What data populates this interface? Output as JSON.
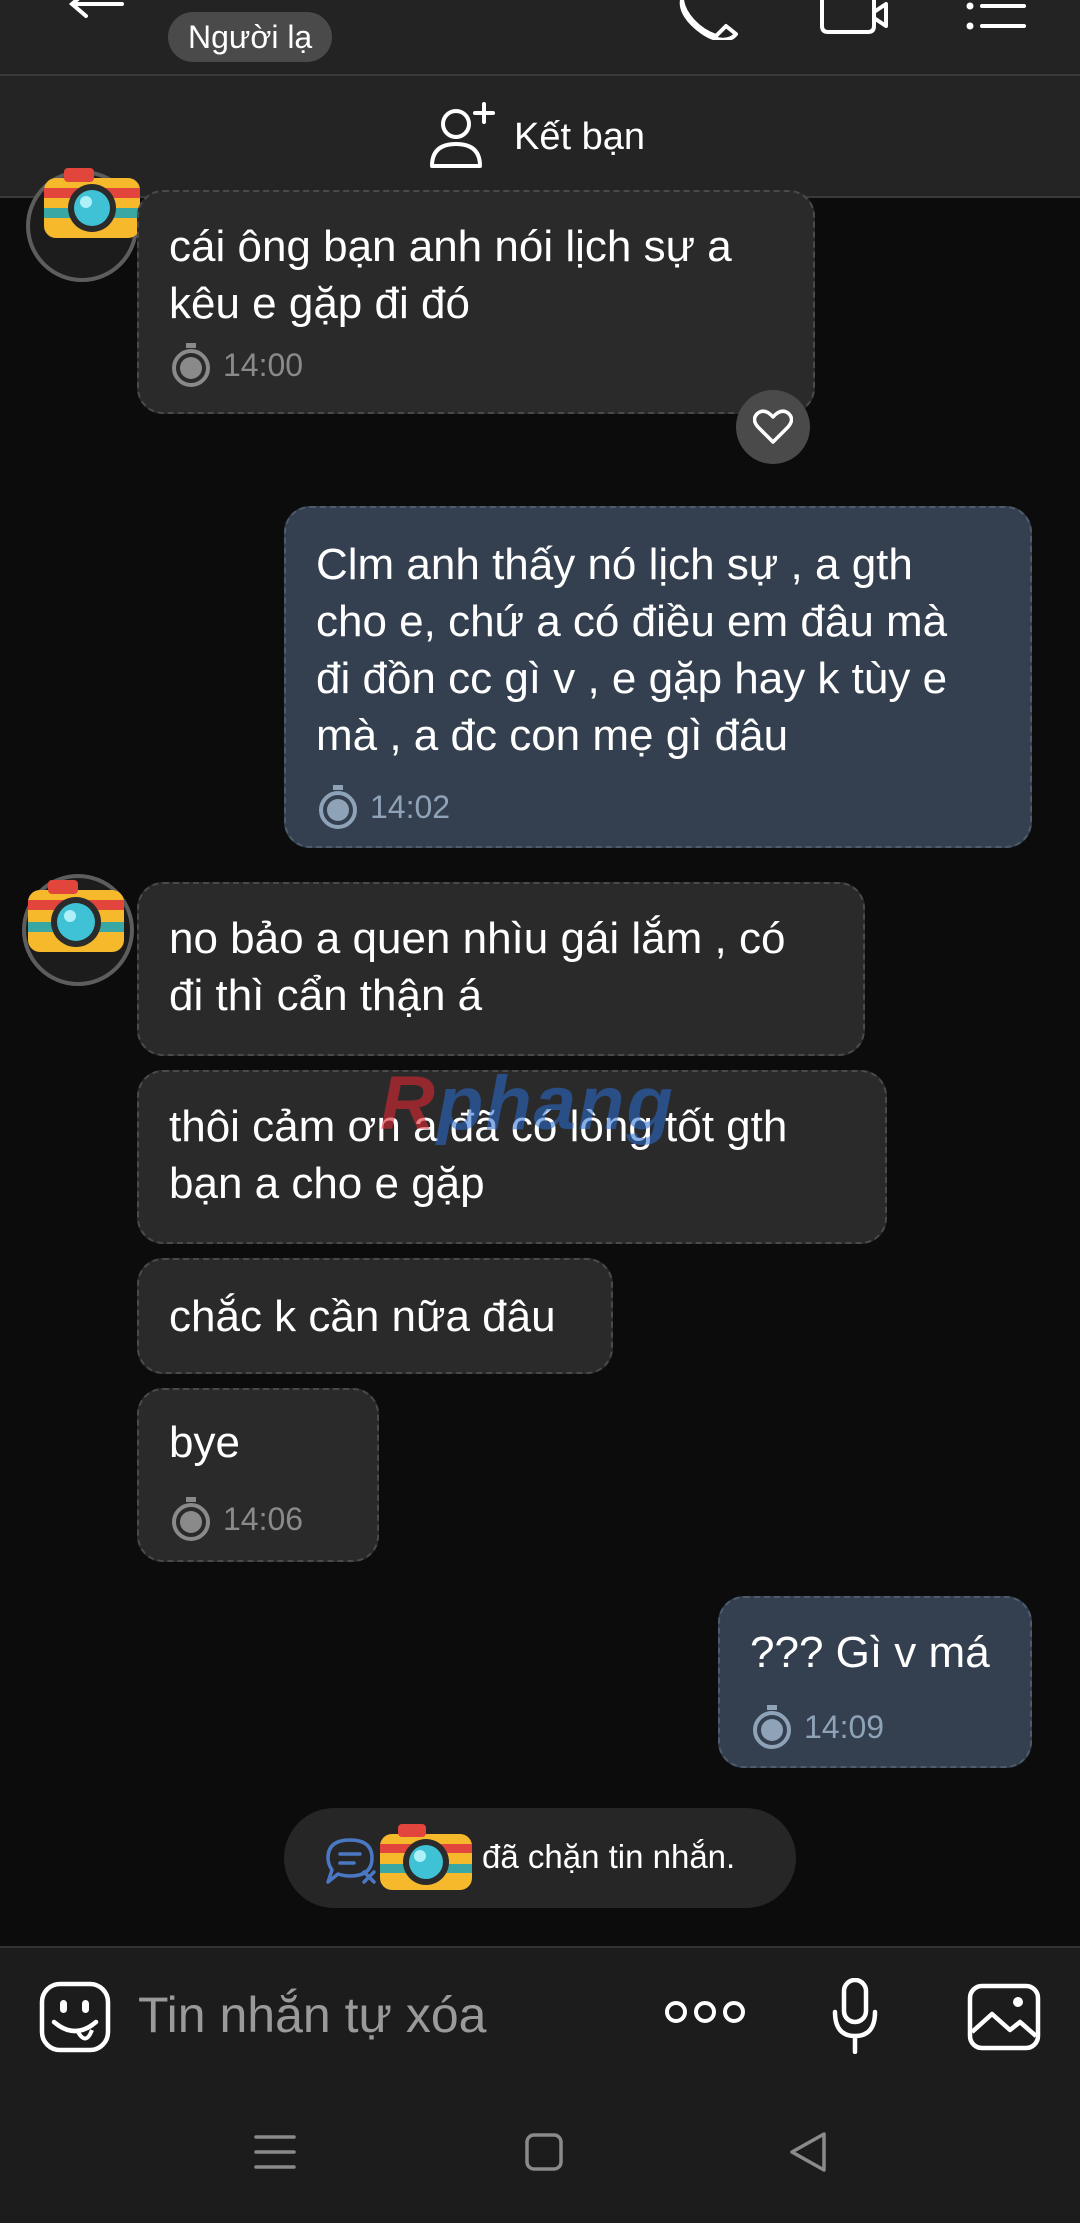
{
  "header": {
    "stranger_label": "Người lạ",
    "add_friend_label": "Kết bạn"
  },
  "messages": [
    {
      "from": "them",
      "text": "cái ông bạn anh nói lịch sự a\nkêu e gặp đi đó",
      "time": "14:00"
    },
    {
      "from": "me",
      "text": "Clm anh thấy nó lịch sự , a gth\ncho e, chứ a có điều em đâu mà\nđi đồn cc gì v , e gặp hay k tùy e\nmà , a đc con mẹ gì đâu",
      "time": "14:02"
    },
    {
      "from": "them",
      "text": "no bảo a quen nhìu gái lắm , có\nđi thì cẩn thận á"
    },
    {
      "from": "them",
      "text": "thôi cảm ơn a đã có lòng tốt gth\nbạn a cho e gặp"
    },
    {
      "from": "them",
      "text": "chắc k cần nữa đâu"
    },
    {
      "from": "them",
      "text": "bye",
      "time": "14:06"
    },
    {
      "from": "me",
      "text": "??? Gì v má",
      "time": "14:09"
    }
  ],
  "watermark": {
    "first": "R",
    "rest": "phang"
  },
  "system_notice": "đã chặn tin nhắn.",
  "composer": {
    "placeholder": "Tin nhắn tự xóa"
  },
  "icons": [
    "back-arrow-icon",
    "phone-icon",
    "video-call-icon",
    "menu-list-icon",
    "add-friend-icon",
    "timer-icon",
    "heart-icon",
    "emoji-icon",
    "more-dots-icon",
    "mic-icon",
    "image-icon",
    "nav-menu-icon",
    "nav-home-icon",
    "nav-back-icon"
  ],
  "colors": {
    "sent_bubble": "#34404f",
    "received_bubble": "#2a2a2a",
    "background": "#0c0c0c"
  }
}
